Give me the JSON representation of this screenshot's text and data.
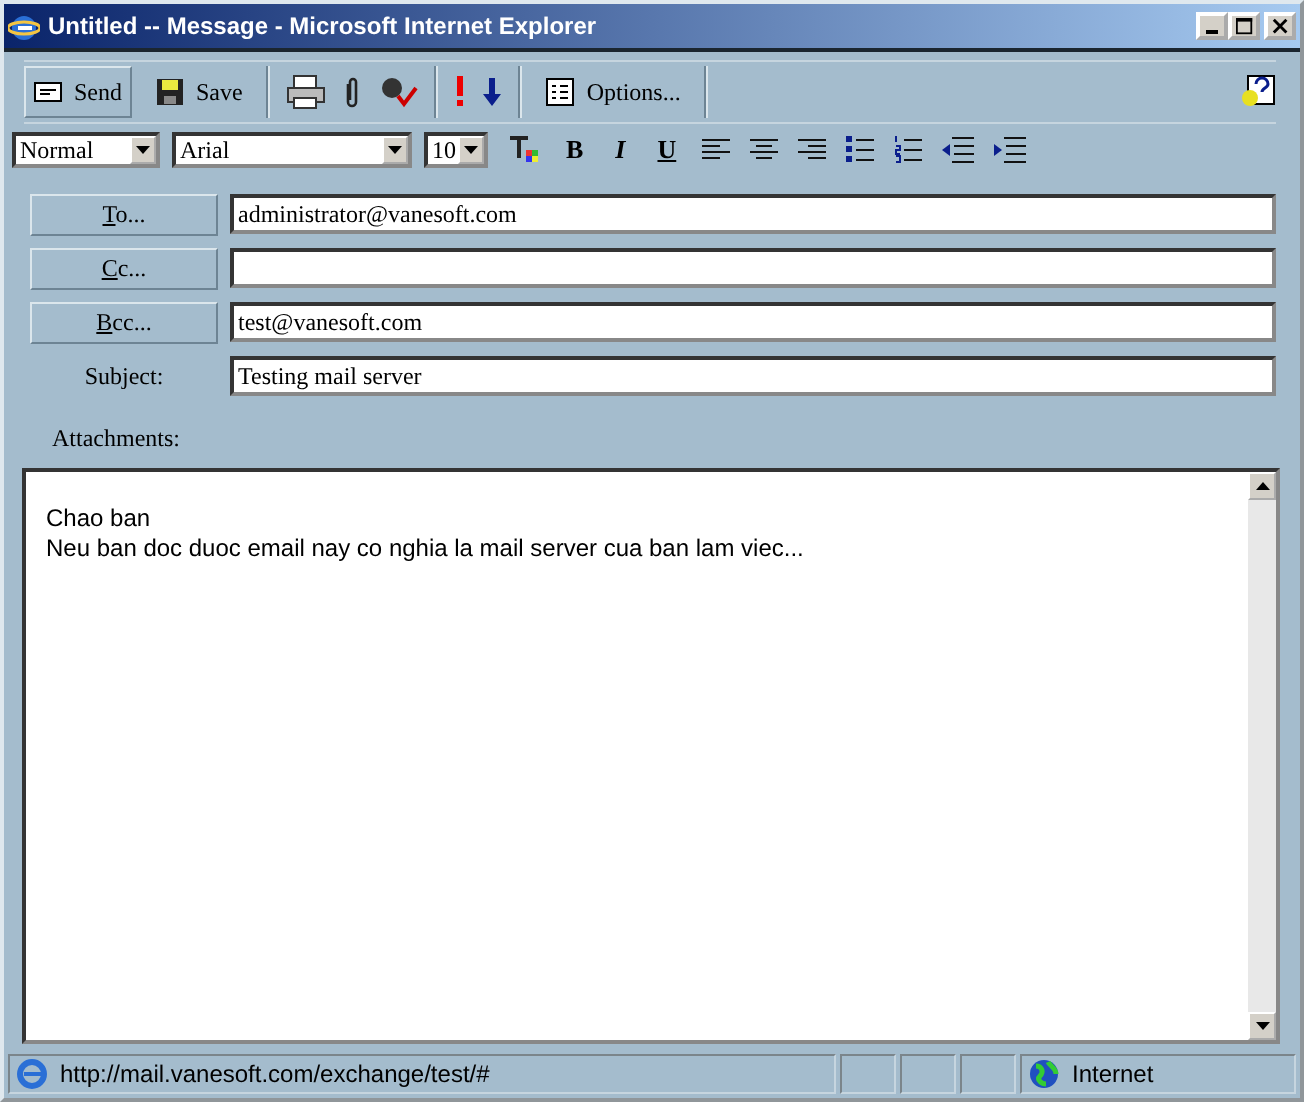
{
  "window": {
    "title": "Untitled -- Message - Microsoft Internet Explorer"
  },
  "toolbar": {
    "send": "Send",
    "save": "Save",
    "options": "Options..."
  },
  "format_bar": {
    "style": "Normal",
    "font": "Arial",
    "size": "10",
    "bold": "B",
    "italic": "I",
    "underline": "U"
  },
  "address_fields": [
    {
      "label": "To...",
      "value": "administrator@vanesoft.com"
    },
    {
      "label": "Cc..."
    },
    {
      "label": "Bcc...",
      "value": "test@vanesoft.com"
    }
  ],
  "subject": {
    "label": "Subject:",
    "value": "Testing mail server"
  },
  "attachments": {
    "label": "Attachments:"
  },
  "body": {
    "lines": [
      "Chao ban",
      "Neu ban doc duoc email nay co nghia la mail server cua ban lam viec..."
    ]
  },
  "status_bar": {
    "url": "http://mail.vanesoft.com/exchange/test/#",
    "zone": "Internet"
  }
}
